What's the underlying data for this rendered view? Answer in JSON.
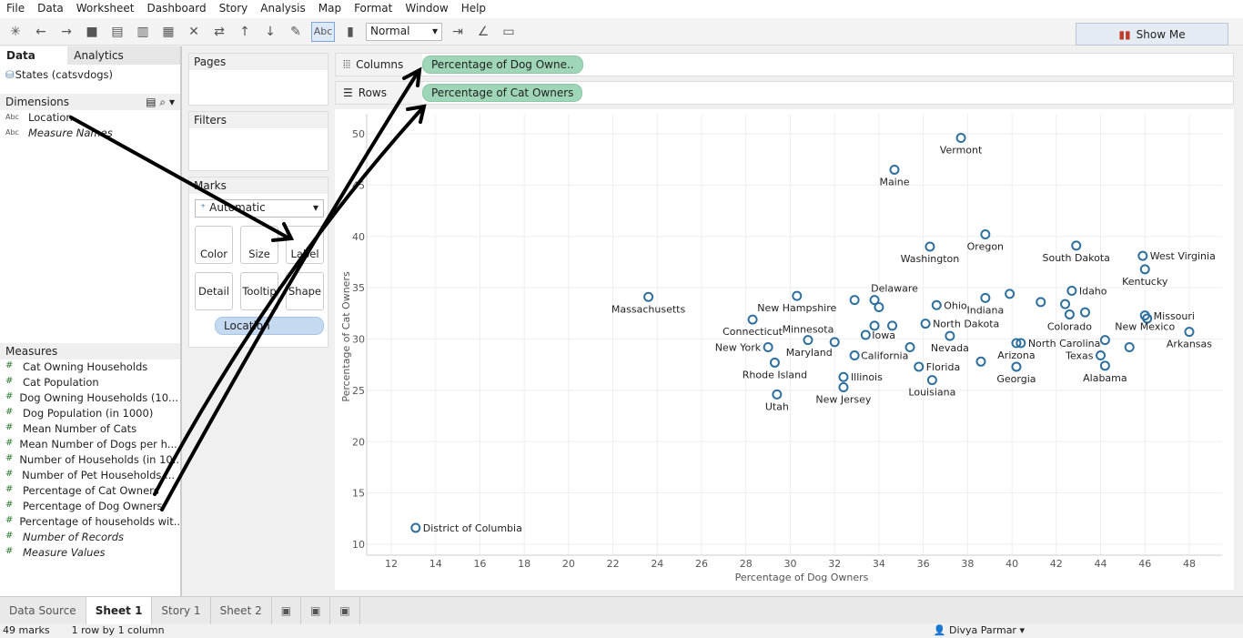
{
  "menu": [
    "File",
    "Data",
    "Worksheet",
    "Dashboard",
    "Story",
    "Analysis",
    "Map",
    "Format",
    "Window",
    "Help"
  ],
  "toolbar": {
    "view_mode": "Normal",
    "abc_label": "Abc",
    "show_me": "Show Me"
  },
  "left": {
    "tabs": [
      "Data",
      "Analytics"
    ],
    "datasource": "States (catsvdogs)",
    "dimensions_title": "Dimensions",
    "dimensions": [
      {
        "label": "Location",
        "italic": false
      },
      {
        "label": "Measure Names",
        "italic": true
      }
    ],
    "measures_title": "Measures",
    "measures": [
      {
        "label": "Cat Owning Households",
        "italic": false
      },
      {
        "label": "Cat Population",
        "italic": false
      },
      {
        "label": "Dog Owning Households (10...",
        "italic": false
      },
      {
        "label": "Dog Population (in 1000)",
        "italic": false
      },
      {
        "label": "Mean Number of Cats",
        "italic": false
      },
      {
        "label": "Mean Number of Dogs per h...",
        "italic": false
      },
      {
        "label": "Number of Households (in 10...",
        "italic": false
      },
      {
        "label": "Number of Pet Households ...",
        "italic": false
      },
      {
        "label": "Percentage of Cat Owners",
        "italic": false
      },
      {
        "label": "Percentage of Dog Owners",
        "italic": false
      },
      {
        "label": "Percentage of households wit...",
        "italic": false
      },
      {
        "label": "Number of Records",
        "italic": true
      },
      {
        "label": "Measure Values",
        "italic": true
      }
    ]
  },
  "cards": {
    "pages": "Pages",
    "filters": "Filters",
    "marks": "Marks",
    "mark_type": "Automatic",
    "buttons": [
      "Color",
      "Size",
      "Label",
      "Detail",
      "Tooltip",
      "Shape"
    ],
    "label_pill": "Location"
  },
  "shelves": {
    "columns_label": "Columns",
    "columns_pill": "Percentage of Dog Owne..",
    "rows_label": "Rows",
    "rows_pill": "Percentage of Cat Owners"
  },
  "chart_data": {
    "type": "scatter",
    "xlabel": "Percentage of Dog Owners",
    "ylabel": "Percentage of Cat Owners",
    "xlim": [
      11,
      50
    ],
    "ylim": [
      9,
      52
    ],
    "xticks": [
      12,
      14,
      16,
      18,
      20,
      22,
      24,
      26,
      28,
      30,
      32,
      34,
      36,
      38,
      40,
      42,
      44,
      46,
      48
    ],
    "yticks": [
      10,
      15,
      20,
      25,
      30,
      35,
      40,
      45,
      50
    ],
    "grid": true,
    "marker": "open-circle",
    "color": "#2e6f9e",
    "points": [
      {
        "name": "Vermont",
        "x": 37.7,
        "y": 49.6
      },
      {
        "name": "Maine",
        "x": 34.7,
        "y": 46.5
      },
      {
        "name": "Oregon",
        "x": 38.8,
        "y": 40.2
      },
      {
        "name": "Washington",
        "x": 36.3,
        "y": 39.0
      },
      {
        "name": "South Dakota",
        "x": 42.9,
        "y": 39.1
      },
      {
        "name": "West Virginia",
        "x": 45.9,
        "y": 38.1
      },
      {
        "name": "Kentucky",
        "x": 46.0,
        "y": 36.8
      },
      {
        "name": "Massachusetts",
        "x": 23.6,
        "y": 34.1
      },
      {
        "name": "New Hampshire",
        "x": 30.3,
        "y": 34.2
      },
      {
        "name": "Delaware",
        "x": 33.8,
        "y": 33.8
      },
      {
        "name": "Ohio",
        "x": 36.6,
        "y": 33.3
      },
      {
        "name": "Indiana",
        "x": 38.8,
        "y": 34.0
      },
      {
        "name": "Idaho",
        "x": 42.7,
        "y": 34.7
      },
      {
        "name": "Colorado",
        "x": 42.6,
        "y": 32.4
      },
      {
        "name": "Missouri",
        "x": 46.1,
        "y": 32.0
      },
      {
        "name": "New Mexico",
        "x": 46.0,
        "y": 32.3
      },
      {
        "name": "Connecticut",
        "x": 28.3,
        "y": 31.9
      },
      {
        "name": "North Dakota",
        "x": 36.1,
        "y": 31.5
      },
      {
        "name": "Minnesota",
        "x": 30.8,
        "y": 29.9
      },
      {
        "name": "Maryland",
        "x": 32.0,
        "y": 29.7
      },
      {
        "name": "Iowa",
        "x": 33.4,
        "y": 30.4
      },
      {
        "name": "California",
        "x": 32.9,
        "y": 28.4
      },
      {
        "name": "Nevada",
        "x": 37.2,
        "y": 30.3
      },
      {
        "name": "North Carolina",
        "x": 40.4,
        "y": 29.6
      },
      {
        "name": "Arizona",
        "x": 40.2,
        "y": 29.6
      },
      {
        "name": "Georgia",
        "x": 40.2,
        "y": 27.3
      },
      {
        "name": "Texas",
        "x": 44.0,
        "y": 28.4
      },
      {
        "name": "Alabama",
        "x": 44.2,
        "y": 27.4
      },
      {
        "name": "Arkansas",
        "x": 48.0,
        "y": 30.7
      },
      {
        "name": "New York",
        "x": 29.0,
        "y": 29.2
      },
      {
        "name": "Rhode Island",
        "x": 29.3,
        "y": 27.7
      },
      {
        "name": "Illinois",
        "x": 32.4,
        "y": 26.3
      },
      {
        "name": "New Jersey",
        "x": 32.4,
        "y": 25.3
      },
      {
        "name": "Florida",
        "x": 35.8,
        "y": 27.3
      },
      {
        "name": "Louisiana",
        "x": 36.4,
        "y": 26.0
      },
      {
        "name": "Utah",
        "x": 29.4,
        "y": 24.6
      },
      {
        "name": "District of Columbia",
        "x": 13.1,
        "y": 11.6
      },
      {
        "name": "",
        "x": 32.9,
        "y": 33.8
      },
      {
        "name": "",
        "x": 34.0,
        "y": 33.1
      },
      {
        "name": "",
        "x": 39.9,
        "y": 34.4
      },
      {
        "name": "",
        "x": 41.3,
        "y": 33.6
      },
      {
        "name": "",
        "x": 42.4,
        "y": 33.4
      },
      {
        "name": "",
        "x": 43.3,
        "y": 32.6
      },
      {
        "name": "",
        "x": 33.8,
        "y": 31.3
      },
      {
        "name": "",
        "x": 34.6,
        "y": 31.3
      },
      {
        "name": "",
        "x": 35.4,
        "y": 29.2
      },
      {
        "name": "",
        "x": 38.6,
        "y": 27.8
      },
      {
        "name": "",
        "x": 44.2,
        "y": 29.9
      },
      {
        "name": "",
        "x": 45.3,
        "y": 29.2
      }
    ]
  },
  "bottom": {
    "tabs": [
      "Data Source",
      "Sheet 1",
      "Story 1",
      "Sheet 2"
    ],
    "active": "Sheet 1"
  },
  "status": {
    "marks": "49 marks",
    "rows": "1 row by 1 column",
    "user": "Divya Parmar"
  }
}
